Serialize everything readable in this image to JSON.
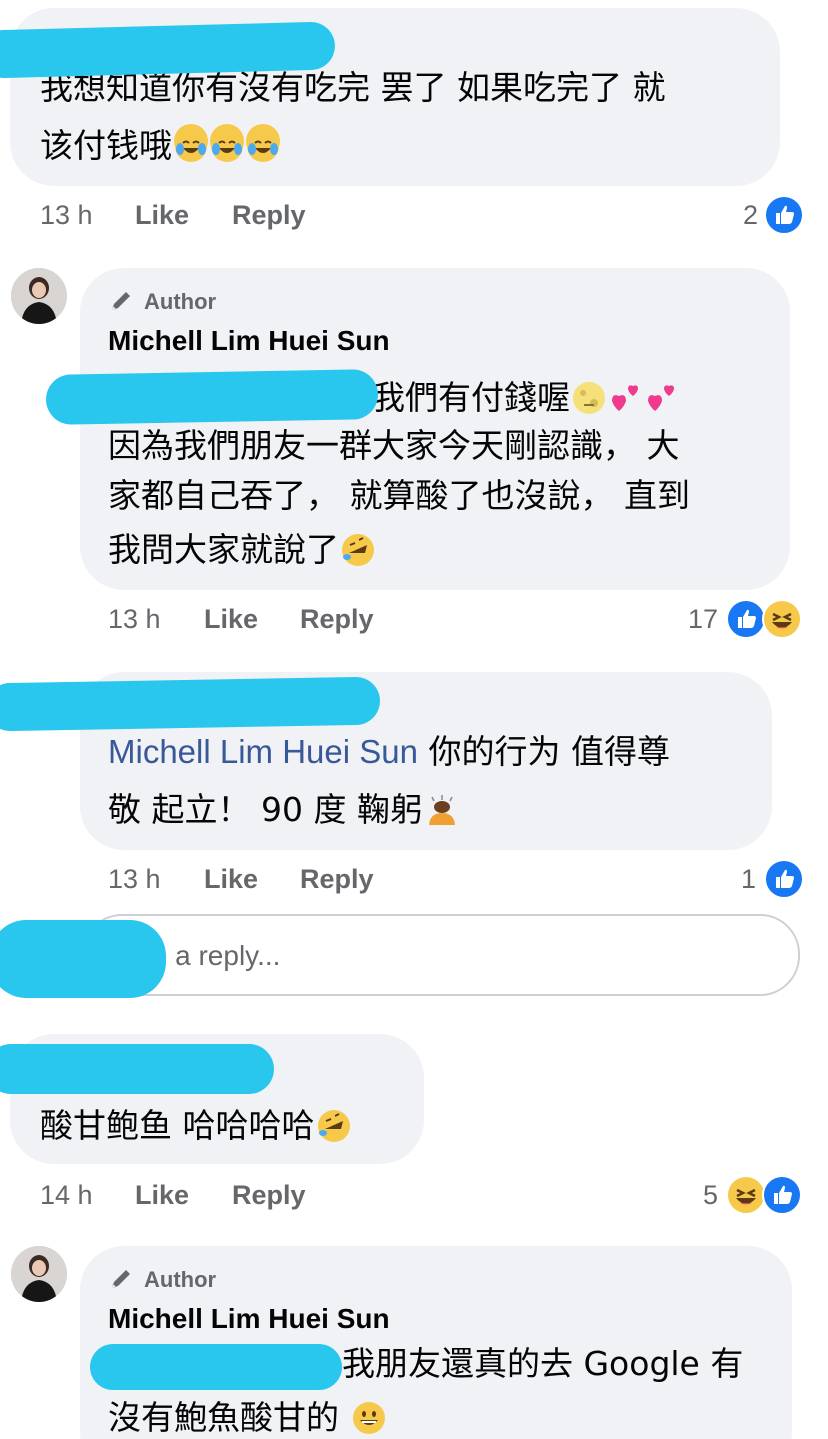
{
  "comments": [
    {
      "text_lines": [
        "我想知道你有沒有吃完  罢了  如果吃完了  就",
        "该付钱哦"
      ],
      "time": "13 h",
      "like_label": "Like",
      "reply_label": "Reply",
      "reaction_count": "2",
      "reactions": [
        "like-icon"
      ]
    },
    {
      "author_badge": "Author",
      "name": "Michell Lim Huei Sun",
      "text_lines": [
        "我們有付錢喔",
        "因為我們朋友一群大家今天剛認識，  大",
        "家都自己吞了，  就算酸了也沒說，  直到",
        "我問大家就說了"
      ],
      "time": "13 h",
      "like_label": "Like",
      "reply_label": "Reply",
      "reaction_count": "17",
      "reactions": [
        "like-icon",
        "haha-icon"
      ]
    },
    {
      "mention": "Michell Lim Huei Sun",
      "text_lines": [
        "你的行为  值得尊",
        "敬  起立！  90 度  鞠躬"
      ],
      "time": "13 h",
      "like_label": "Like",
      "reply_label": "Reply",
      "reaction_count": "1",
      "reactions": [
        "like-icon"
      ]
    },
    {
      "text_lines": [
        "酸甘鲍鱼  哈哈哈哈"
      ],
      "time": "14 h",
      "like_label": "Like",
      "reply_label": "Reply",
      "reaction_count": "5",
      "reactions": [
        "haha-icon",
        "like-icon"
      ]
    },
    {
      "author_badge": "Author",
      "name": "Michell Lim Huei Sun",
      "text_lines": [
        "我朋友還真的去 Google 有",
        "沒有鮑魚酸甘的"
      ]
    }
  ],
  "reply_input": {
    "placeholder": "te a reply..."
  },
  "colors": {
    "bubble": "#f0f2f5",
    "like_blue": "#1877f2",
    "mention_blue": "#385898",
    "redaction": "#29c6ee",
    "meta_gray": "#65676b"
  }
}
